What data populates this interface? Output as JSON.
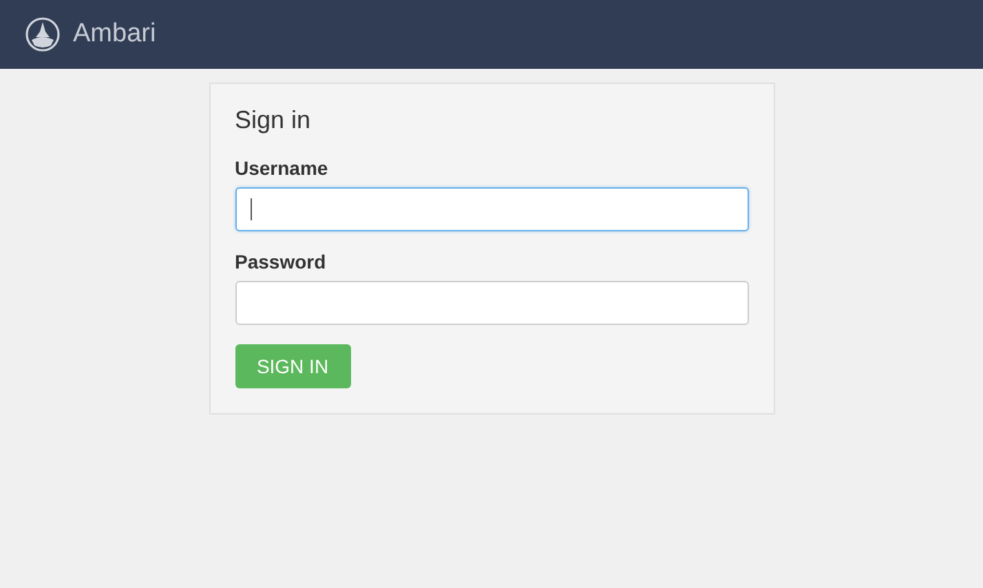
{
  "header": {
    "app_name": "Ambari"
  },
  "form": {
    "title": "Sign in",
    "fields": [
      {
        "label": "Username",
        "focused": true
      },
      {
        "label": "Password",
        "focused": false
      }
    ],
    "submit": "SIGN IN"
  }
}
